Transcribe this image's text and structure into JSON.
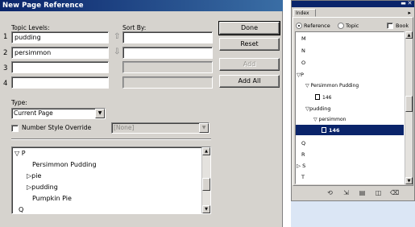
{
  "dialog": {
    "title": "New Page Reference",
    "topic_levels_label": "Topic Levels:",
    "sort_by_label": "Sort By:",
    "levels": [
      {
        "num": "1",
        "topic": "pudding",
        "sort": ""
      },
      {
        "num": "2",
        "topic": "persimmon",
        "sort": ""
      },
      {
        "num": "3",
        "topic": "",
        "sort": ""
      },
      {
        "num": "4",
        "topic": "",
        "sort": ""
      }
    ],
    "arrow_up_glyph": "⇧",
    "arrow_down_glyph": "⇩",
    "buttons": {
      "done": "Done",
      "reset": "Reset",
      "add": "Add",
      "add_all": "Add All"
    },
    "type_label": "Type:",
    "type_value": "Current Page",
    "number_style_label": "Number Style Override",
    "number_style_value": "[None]",
    "topic_list": {
      "items": [
        {
          "glyph": "▽",
          "text": "P"
        },
        {
          "glyph": "",
          "text": "Persimmon Pudding"
        },
        {
          "glyph": "▷",
          "text": "pie"
        },
        {
          "glyph": "▷",
          "text": "pudding"
        },
        {
          "glyph": "",
          "text": "Pumpkin Pie"
        },
        {
          "glyph": "",
          "text": "Q"
        }
      ]
    }
  },
  "index_panel": {
    "tab_label": "Index",
    "radio_reference": "Reference",
    "radio_topic": "Topic",
    "book_label": "Book",
    "items": [
      {
        "glyph": "",
        "text": "M"
      },
      {
        "glyph": "",
        "text": "N"
      },
      {
        "glyph": "",
        "text": "O"
      },
      {
        "glyph": "▽",
        "text": "P"
      },
      {
        "glyph": "▽",
        "text": "Persimmon Pudding"
      },
      {
        "glyph": "",
        "text": "146"
      },
      {
        "glyph": "▽",
        "text": "pudding"
      },
      {
        "glyph": "▽",
        "text": "persimmon"
      },
      {
        "glyph": "",
        "text": "146"
      },
      {
        "glyph": "",
        "text": "Q"
      },
      {
        "glyph": "",
        "text": "R"
      },
      {
        "glyph": "▷",
        "text": "S"
      },
      {
        "glyph": "",
        "text": "T"
      }
    ]
  }
}
